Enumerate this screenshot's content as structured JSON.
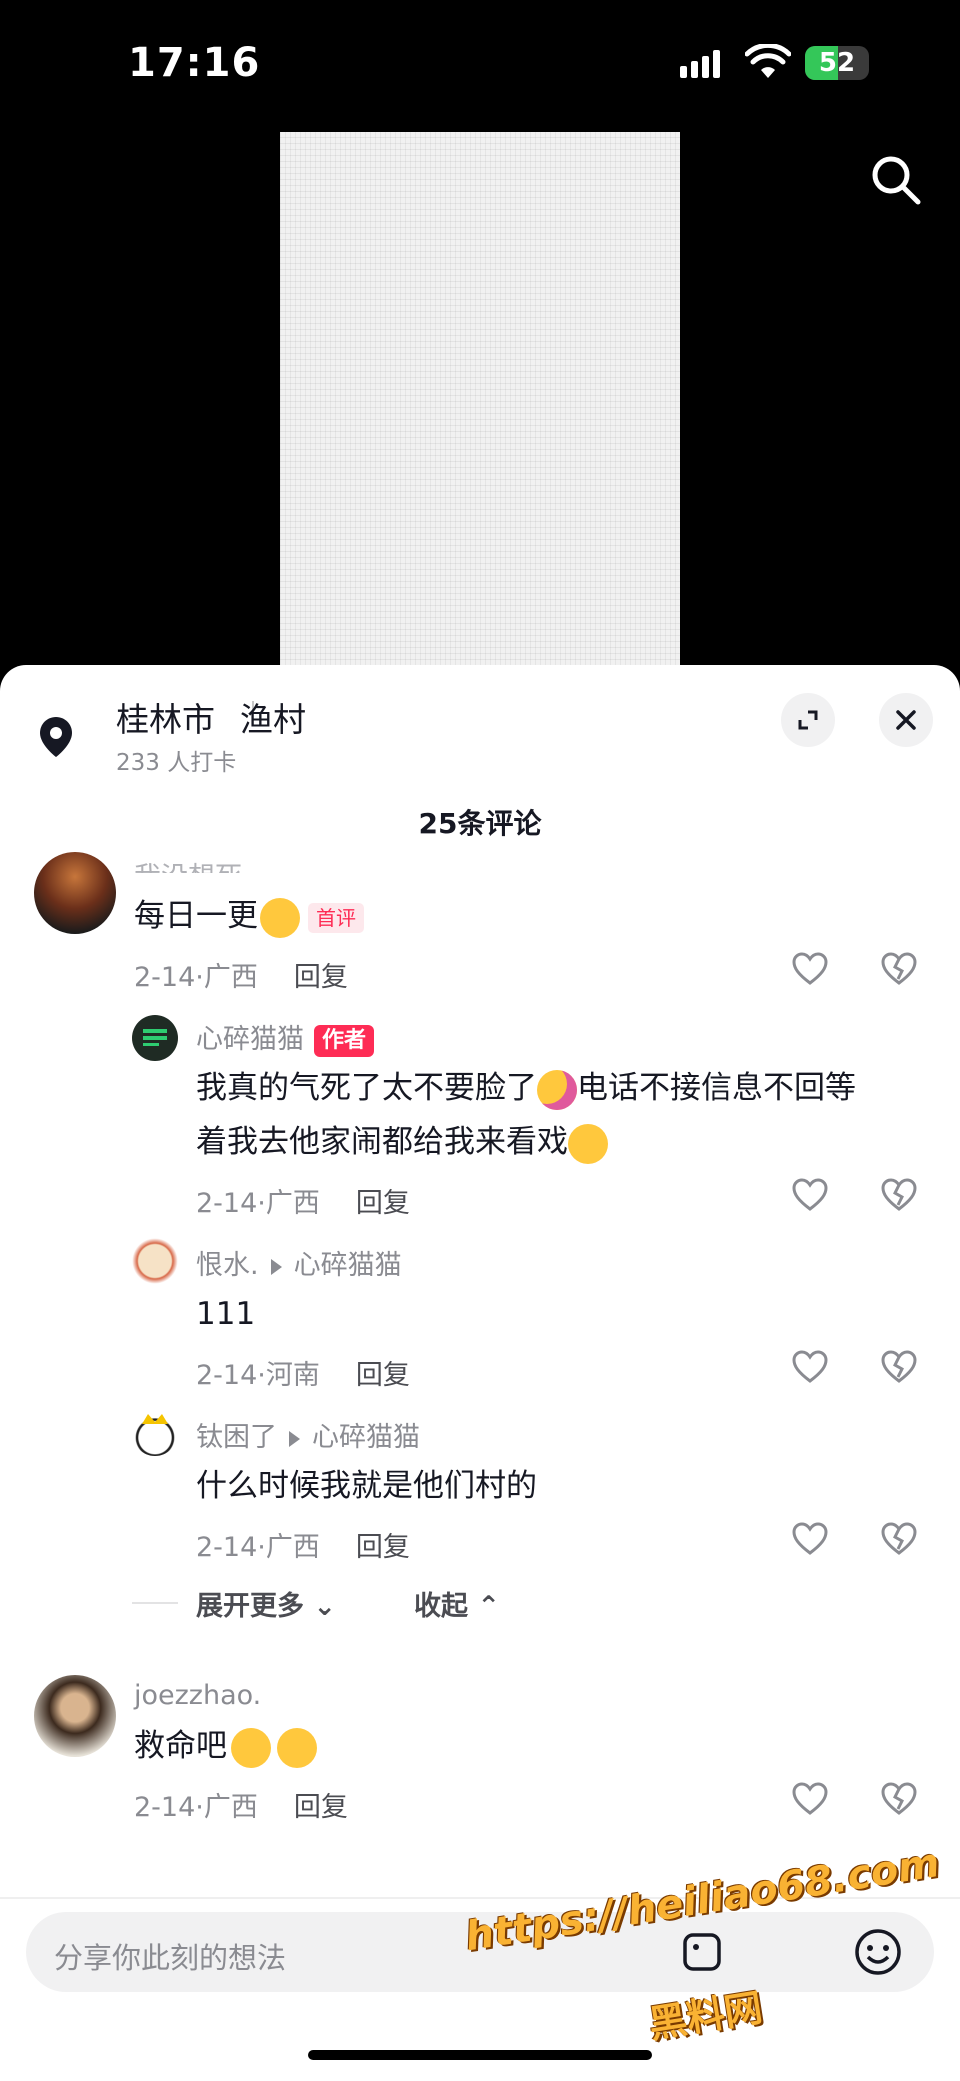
{
  "status_bar": {
    "time": "17:16",
    "battery": "52"
  },
  "location": {
    "city": "桂林市",
    "place": "渔村",
    "checkins": "233 人打卡"
  },
  "comments_header": "25条评论",
  "comments": [
    {
      "username": "我没想死",
      "text": "每日一更",
      "badge": "首评",
      "date": "2-14",
      "region": "广西",
      "reply_label": "回复",
      "replies": [
        {
          "username": "心碎猫猫",
          "badge": "作者",
          "text_line1": "我真的气死了太不要脸了",
          "text_line1b": "电话不接信息不回等",
          "text_line2": "着我去他家闹都给我来看戏",
          "date": "2-14",
          "region": "广西",
          "reply_label": "回复"
        },
        {
          "username": "恨水.",
          "reply_to": "心碎猫猫",
          "text": "111",
          "date": "2-14",
          "region": "河南",
          "reply_label": "回复"
        },
        {
          "username": "钛困了",
          "reply_to": "心碎猫猫",
          "text": "什么时候我就是他们村的",
          "date": "2-14",
          "region": "广西",
          "reply_label": "回复"
        }
      ],
      "expand_more": "展开更多",
      "collapse": "收起"
    },
    {
      "username": "joezzhao.",
      "text": "救命吧",
      "date": "2-14",
      "region": "广西",
      "reply_label": "回复"
    }
  ],
  "input": {
    "placeholder": "分享你此刻的想法"
  },
  "watermark": {
    "url": "https://heiliao68.com",
    "name": "黑料网"
  },
  "colors": {
    "accent": "#fe2c55",
    "sheet_bg": "#ffffff"
  }
}
